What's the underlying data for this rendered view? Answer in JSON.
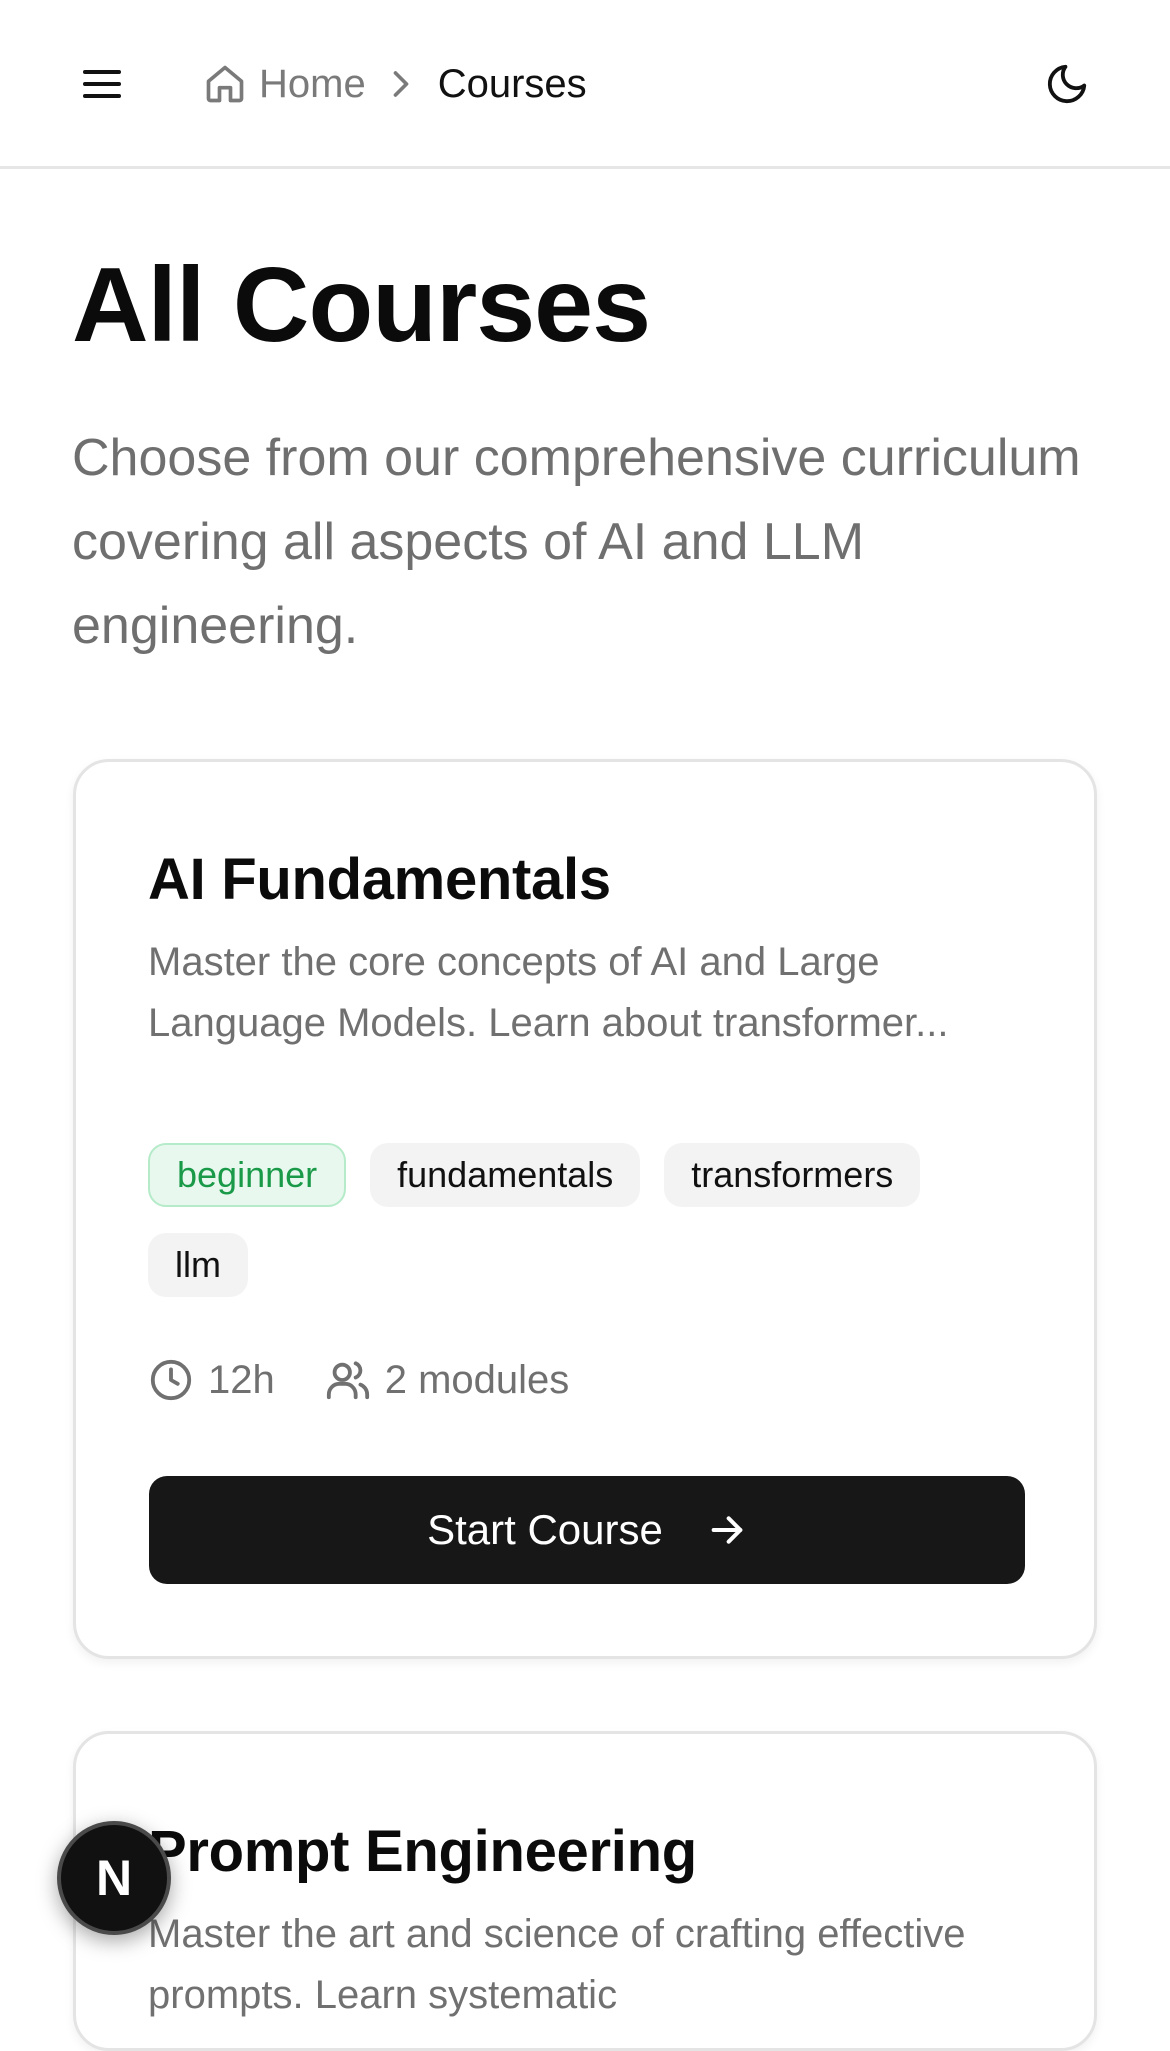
{
  "header": {
    "menu_icon": "hamburger-menu-icon",
    "theme_icon": "moon-icon",
    "breadcrumb": {
      "home_icon": "home-icon",
      "home_label": "Home",
      "separator_icon": "chevron-right-icon",
      "current_label": "Courses"
    }
  },
  "page": {
    "title": "All Courses",
    "description": "Choose from our comprehensive curriculum covering all aspects of AI and LLM engineering."
  },
  "courses": [
    {
      "title": "AI Fundamentals",
      "description": "Master the core concepts of AI and Large Language Models. Learn about transformer...",
      "level_tag": "beginner",
      "tags": [
        "fundamentals",
        "transformers",
        "llm"
      ],
      "duration": "12h",
      "modules": "2 modules",
      "button_label": "Start Course"
    },
    {
      "title": "Prompt Engineering",
      "description": "Master the art and science of crafting effective prompts. Learn systematic"
    }
  ],
  "floating_badge": {
    "letter": "N"
  },
  "colors": {
    "level_beginner_text": "#1a9a48",
    "level_beginner_bg": "#e8f8ee",
    "primary_button": "#171717"
  }
}
